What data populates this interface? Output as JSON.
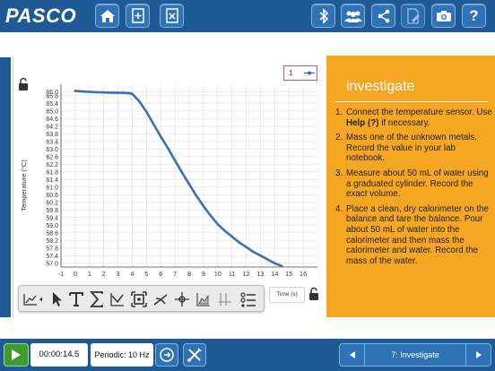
{
  "header": {
    "logo_text": "PASCO",
    "buttons": [
      "home-icon",
      "add-page-icon",
      "delete-page-icon",
      "bluetooth-icon",
      "group-icon",
      "share-icon",
      "annotate-icon",
      "camera-icon",
      "help-icon"
    ],
    "help_label": "?"
  },
  "graph": {
    "ylabel": "Temperature (°C)",
    "xlabel": "Time (s)",
    "legend_label": "1",
    "color": "#3a6fb5"
  },
  "chart_data": {
    "type": "line",
    "title": "",
    "xlabel": "Time (s)",
    "ylabel": "Temperature (°C)",
    "xlim": [
      -1,
      17
    ],
    "ylim": [
      56.8,
      66.4
    ],
    "x_ticks": [
      "-1",
      "0",
      "1",
      "2",
      "3",
      "4",
      "5",
      "6",
      "7",
      "8",
      "9",
      "10",
      "11",
      "12",
      "13",
      "14",
      "15",
      "16"
    ],
    "y_ticks": [
      "57.0",
      "57.4",
      "57.8",
      "58.2",
      "58.6",
      "59.0",
      "59.4",
      "59.8",
      "60.2",
      "60.6",
      "61.0",
      "61.4",
      "61.8",
      "62.2",
      "62.6",
      "63.0",
      "63.4",
      "63.8",
      "64.2",
      "64.6",
      "65.0",
      "65.4",
      "65.8",
      "66.0"
    ],
    "grid": true,
    "series": [
      {
        "name": "1",
        "x": [
          0,
          0.5,
          1,
          1.5,
          2,
          2.5,
          3,
          3.5,
          4,
          4.5,
          5,
          5.5,
          6,
          6.5,
          7,
          7.5,
          8,
          8.5,
          9,
          9.5,
          10,
          10.5,
          11,
          11.5,
          12,
          12.5,
          13,
          13.5,
          14,
          14.5
        ],
        "y": [
          66.05,
          66.02,
          66.0,
          65.98,
          65.97,
          65.96,
          65.95,
          65.95,
          65.9,
          65.5,
          64.95,
          64.3,
          63.65,
          63.05,
          62.4,
          61.75,
          61.15,
          60.55,
          60.0,
          59.5,
          59.05,
          58.7,
          58.4,
          58.1,
          57.85,
          57.6,
          57.4,
          57.2,
          57.0,
          56.85
        ]
      }
    ]
  },
  "toolbar": {
    "tools": [
      "graph-type-icon",
      "select-icon",
      "text-tool-icon",
      "sum-icon",
      "curve-fit-icon",
      "scale-icon",
      "slope-icon",
      "coordinate-icon",
      "area-icon",
      "delta-icon",
      "more-icon"
    ],
    "xaxis_label": "Time (s)"
  },
  "side": {
    "title": "investigate",
    "steps": [
      {
        "num": "1.",
        "pre": "Connect the temperature sensor. Use ",
        "bold": "Help (?)",
        "post": " if necessary."
      },
      {
        "num": "2.",
        "pre": "Mass one of the unknown metals. Record the value in your lab notebook.",
        "bold": "",
        "post": ""
      },
      {
        "num": "3.",
        "pre": "Measure about 50 mL of water using a graduated cylinder. Record the exact volume.",
        "bold": "",
        "post": ""
      },
      {
        "num": "4.",
        "pre": "Place a clean, dry calorimeter on the balance and tare the balance. Pour about 50 mL of water into the calorimeter and then mass the calorimeter and water. Record the mass of the water.",
        "bold": "",
        "post": ""
      }
    ]
  },
  "footer": {
    "timer": "00:00:14.5",
    "sample_rate": "Periodic: 10 Hz",
    "page_label": "7: Investigate",
    "colors": {
      "bar": "#1e5a96",
      "play": "#3f9b2e",
      "accent": "#f5a623"
    }
  }
}
